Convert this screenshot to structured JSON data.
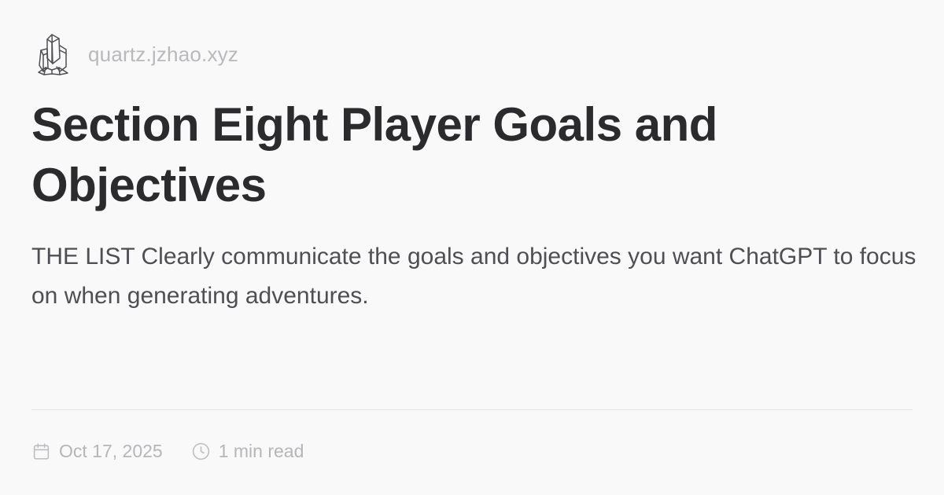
{
  "site": {
    "logo_icon": "crystal-cluster-logo-icon",
    "name": "quartz.jzhao.xyz"
  },
  "article": {
    "title": "Section Eight Player Goals and Objectives",
    "description": "THE LIST Clearly communicate the goals and objectives you want ChatGPT to focus on when generating adventures."
  },
  "meta": {
    "date_icon": "calendar-icon",
    "date": "Oct 17, 2025",
    "read_time_icon": "clock-icon",
    "read_time": "1 min read"
  },
  "colors": {
    "background": "#faf9fa",
    "title": "#2b2b2e",
    "description": "#4e4e53",
    "muted": "#b6b5b9"
  }
}
